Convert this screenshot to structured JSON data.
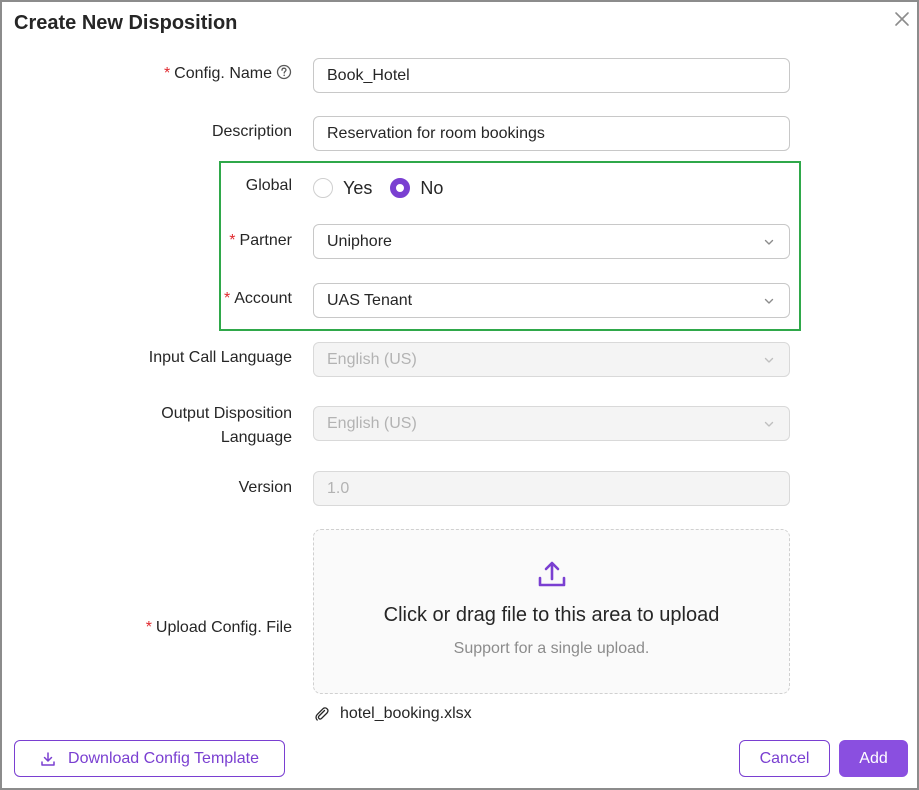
{
  "dialog": {
    "title": "Create New Disposition"
  },
  "fields": {
    "config_name": {
      "label": "Config. Name",
      "value": "Book_Hotel"
    },
    "description": {
      "label": "Description",
      "value": "Reservation for room bookings"
    },
    "global": {
      "label": "Global",
      "options": [
        "Yes",
        "No"
      ],
      "selected": "No"
    },
    "partner": {
      "label": "Partner",
      "value": "Uniphore"
    },
    "account": {
      "label": "Account",
      "value": "UAS Tenant"
    },
    "input_call_language": {
      "label": "Input Call Language",
      "value": "English (US)"
    },
    "output_disposition_language": {
      "label_line1": "Output Disposition",
      "label_line2": "Language",
      "value": "English (US)"
    },
    "version": {
      "label": "Version",
      "value": "1.0"
    },
    "upload": {
      "label": "Upload Config. File",
      "main_text": "Click or drag file to this area to upload",
      "sub_text": "Support for a single upload.",
      "file_name": "hotel_booking.xlsx"
    }
  },
  "footer": {
    "download_label": "Download Config Template",
    "cancel_label": "Cancel",
    "add_label": "Add"
  },
  "colors": {
    "accent": "#7a3fd1",
    "primary_button": "#8a4fe0",
    "required": "#e0282e",
    "highlight_border": "#2fa84a"
  },
  "icons": {
    "close": "close-icon",
    "help": "question-circle-icon",
    "chevron": "chevron-down-icon",
    "upload": "upload-icon",
    "attachment": "paperclip-icon",
    "download": "download-icon"
  }
}
